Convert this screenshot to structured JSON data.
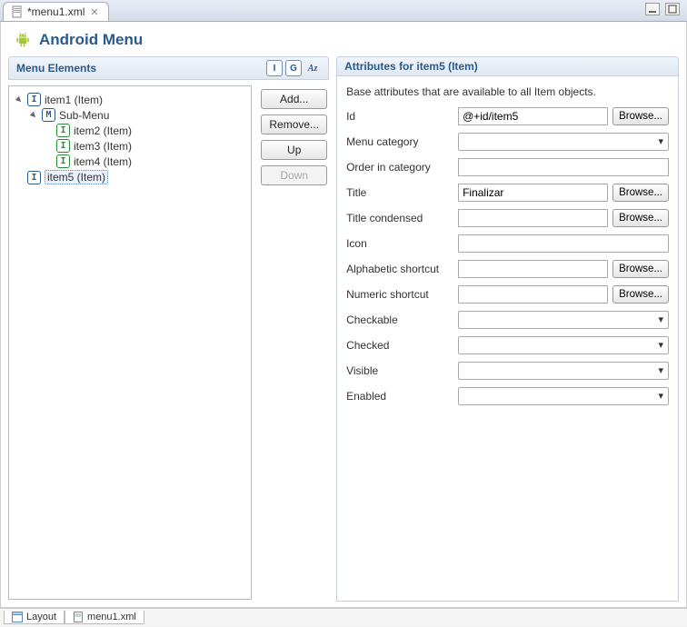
{
  "tab": {
    "label": "*menu1.xml"
  },
  "page_title": "Android Menu",
  "left": {
    "header": "Menu Elements",
    "toolbar": {
      "i": "I",
      "g": "G",
      "az": "Az"
    },
    "buttons": {
      "add": "Add...",
      "remove": "Remove...",
      "up": "Up",
      "down": "Down"
    },
    "tree": {
      "item1": "item1 (Item)",
      "submenu": "Sub-Menu",
      "item2": "item2 (Item)",
      "item3": "item3 (Item)",
      "item4": "item4 (Item)",
      "item5": "item5 (Item)"
    }
  },
  "right": {
    "header": "Attributes for item5 (Item)",
    "desc": "Base attributes that are available to all Item objects.",
    "browse": "Browse...",
    "rows": {
      "id": {
        "label": "Id",
        "value": "@+id/item5"
      },
      "menu_category": {
        "label": "Menu category",
        "value": ""
      },
      "order_in_category": {
        "label": "Order in category",
        "value": ""
      },
      "title": {
        "label": "Title",
        "value": "Finalizar"
      },
      "title_condensed": {
        "label": "Title condensed",
        "value": ""
      },
      "icon": {
        "label": "Icon",
        "value": ""
      },
      "alpha_shortcut": {
        "label": "Alphabetic shortcut",
        "value": ""
      },
      "numeric_shortcut": {
        "label": "Numeric shortcut",
        "value": ""
      },
      "checkable": {
        "label": "Checkable",
        "value": ""
      },
      "checked": {
        "label": "Checked",
        "value": ""
      },
      "visible": {
        "label": "Visible",
        "value": ""
      },
      "enabled": {
        "label": "Enabled",
        "value": ""
      }
    }
  },
  "bottom_tabs": {
    "layout": "Layout",
    "file": "menu1.xml"
  }
}
